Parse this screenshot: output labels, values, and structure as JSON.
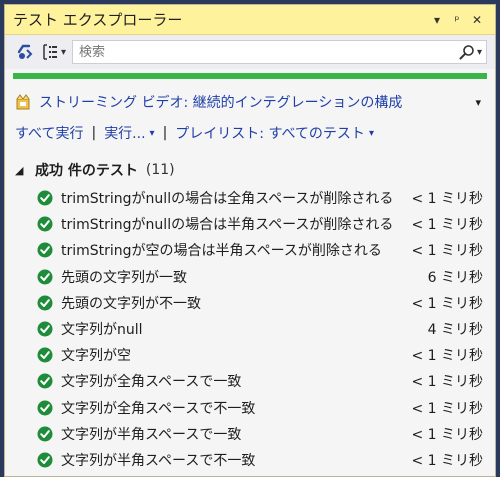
{
  "window": {
    "title": "テスト エクスプローラー",
    "controls": [
      "▾",
      "ᵖ",
      "✕"
    ]
  },
  "toolbar": {
    "search_placeholder": "検索",
    "group_icon_caret": "▾",
    "search_caret": "▾"
  },
  "playlist": {
    "label": "ストリーミング ビデオ: 継続的インテグレーションの構成",
    "caret": "▾"
  },
  "actions": {
    "run_all": "すべて実行",
    "run": "実行...",
    "playlist": "プレイリスト: すべてのテスト",
    "sep": "|",
    "caret": "▾"
  },
  "group": {
    "arrow": "◢",
    "label": "成功 件のテスト",
    "count": "(11)"
  },
  "tests": [
    {
      "name": "trimStringがnullの場合は全角スペースが削除される",
      "time": "< 1 ミリ秒"
    },
    {
      "name": "trimStringがnullの場合は半角スペースが削除される",
      "time": "< 1 ミリ秒"
    },
    {
      "name": "trimStringが空の場合は半角スペースが削除される",
      "time": "< 1 ミリ秒"
    },
    {
      "name": "先頭の文字列が一致",
      "time": "6 ミリ秒"
    },
    {
      "name": "先頭の文字列が不一致",
      "time": "< 1 ミリ秒"
    },
    {
      "name": "文字列がnull",
      "time": "4 ミリ秒"
    },
    {
      "name": "文字列が空",
      "time": "< 1 ミリ秒"
    },
    {
      "name": "文字列が全角スペースで一致",
      "time": "< 1 ミリ秒"
    },
    {
      "name": "文字列が全角スペースで不一致",
      "time": "< 1 ミリ秒"
    },
    {
      "name": "文字列が半角スペースで一致",
      "time": "< 1 ミリ秒"
    },
    {
      "name": "文字列が半角スペースで不一致",
      "time": "< 1 ミリ秒"
    }
  ],
  "colors": {
    "title_bar": "#fff29d",
    "progress": "#3ab54a",
    "link": "#1f3fa8",
    "pass_icon": "#1e8c3a"
  }
}
